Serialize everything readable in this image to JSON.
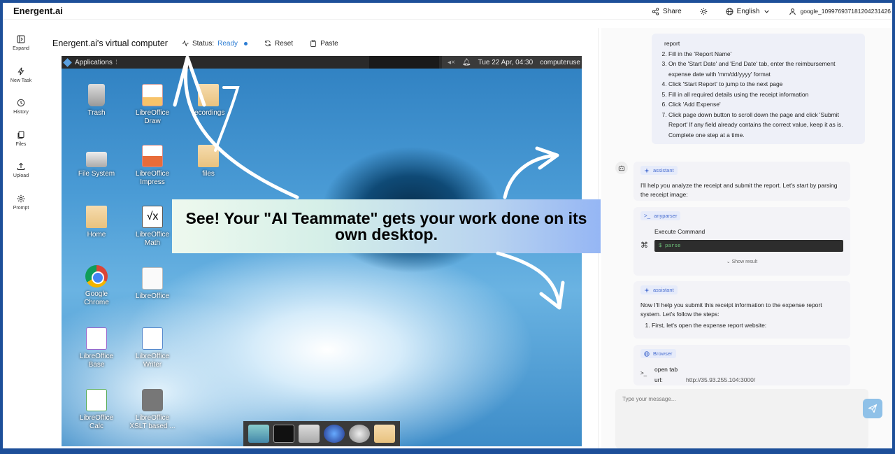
{
  "app": {
    "brand": "Energent.ai"
  },
  "topbar": {
    "share_label": "Share",
    "theme_icon": "sun-icon",
    "language_label": "English",
    "user_label": "google_109976937181204231426"
  },
  "rail": {
    "items": [
      {
        "label": "Expand",
        "icon": "expand-icon"
      },
      {
        "label": "New Task",
        "icon": "lightning-icon"
      },
      {
        "label": "History",
        "icon": "history-icon"
      },
      {
        "label": "Files",
        "icon": "files-icon"
      },
      {
        "label": "Upload",
        "icon": "upload-icon"
      },
      {
        "label": "Prompt",
        "icon": "gear-icon"
      }
    ]
  },
  "vm": {
    "title": "Energent.ai's virtual computer",
    "status_label": "Status:",
    "status_value": "Ready",
    "reset_label": "Reset",
    "paste_label": "Paste",
    "colors": {
      "status": "#2b7cd3"
    },
    "desktop": {
      "applications_label": "Applications",
      "clock": "Tue 22 Apr, 04:30",
      "user": "computeruse",
      "icons": [
        {
          "label": "Trash"
        },
        {
          "label": "LibreOffice Draw"
        },
        {
          "label": "recordings"
        },
        {
          "label": "File System"
        },
        {
          "label": "LibreOffice Impress"
        },
        {
          "label": "files"
        },
        {
          "label": "Home"
        },
        {
          "label": "LibreOffice Math"
        },
        {
          "label": "Google Chrome"
        },
        {
          "label": "LibreOffice"
        },
        {
          "label": "LibreOffice Base"
        },
        {
          "label": "LibreOffice Writer"
        },
        {
          "label": "LibreOffice Calc"
        },
        {
          "label": "LibreOffice XSLT based ..."
        }
      ]
    }
  },
  "promo": {
    "text": "See! Your \"AI Teammate\" gets your work done on its own desktop."
  },
  "chat": {
    "user_message": {
      "first_line": "report",
      "steps": [
        "Fill in the 'Report Name'",
        "On the 'Start Date' and 'End Date' tab, enter the reimbursement expense date with 'mm/dd/yyyy' format",
        "Click 'Start Report' to jump to the next page",
        "Fill in all required details using the receipt information",
        "Click 'Add Expense'",
        "Click page down button to scroll down the page and click 'Submit Report' If any field already contains the correct value, keep it as is. Complete one step at a time."
      ]
    },
    "msg1": {
      "tag": "assistant",
      "text": "I'll help you analyze the receipt and submit the report. Let's start by parsing the receipt image:"
    },
    "tool1": {
      "tag": "anyparser",
      "title": "Execute Command",
      "command": "$ parse",
      "show_result": "Show result"
    },
    "msg2": {
      "tag": "assistant",
      "text": "Now I'll help you submit this receipt information to the expense report system. Let's follow the steps:",
      "list_item": "First, let's open the expense report website:"
    },
    "tool2": {
      "tag": "Browser",
      "action": "open tab",
      "url_label": "url:",
      "url_value": "http://35.93.255.104:3000/"
    },
    "input_placeholder": "Type your message...",
    "send_icon": "send-icon"
  }
}
